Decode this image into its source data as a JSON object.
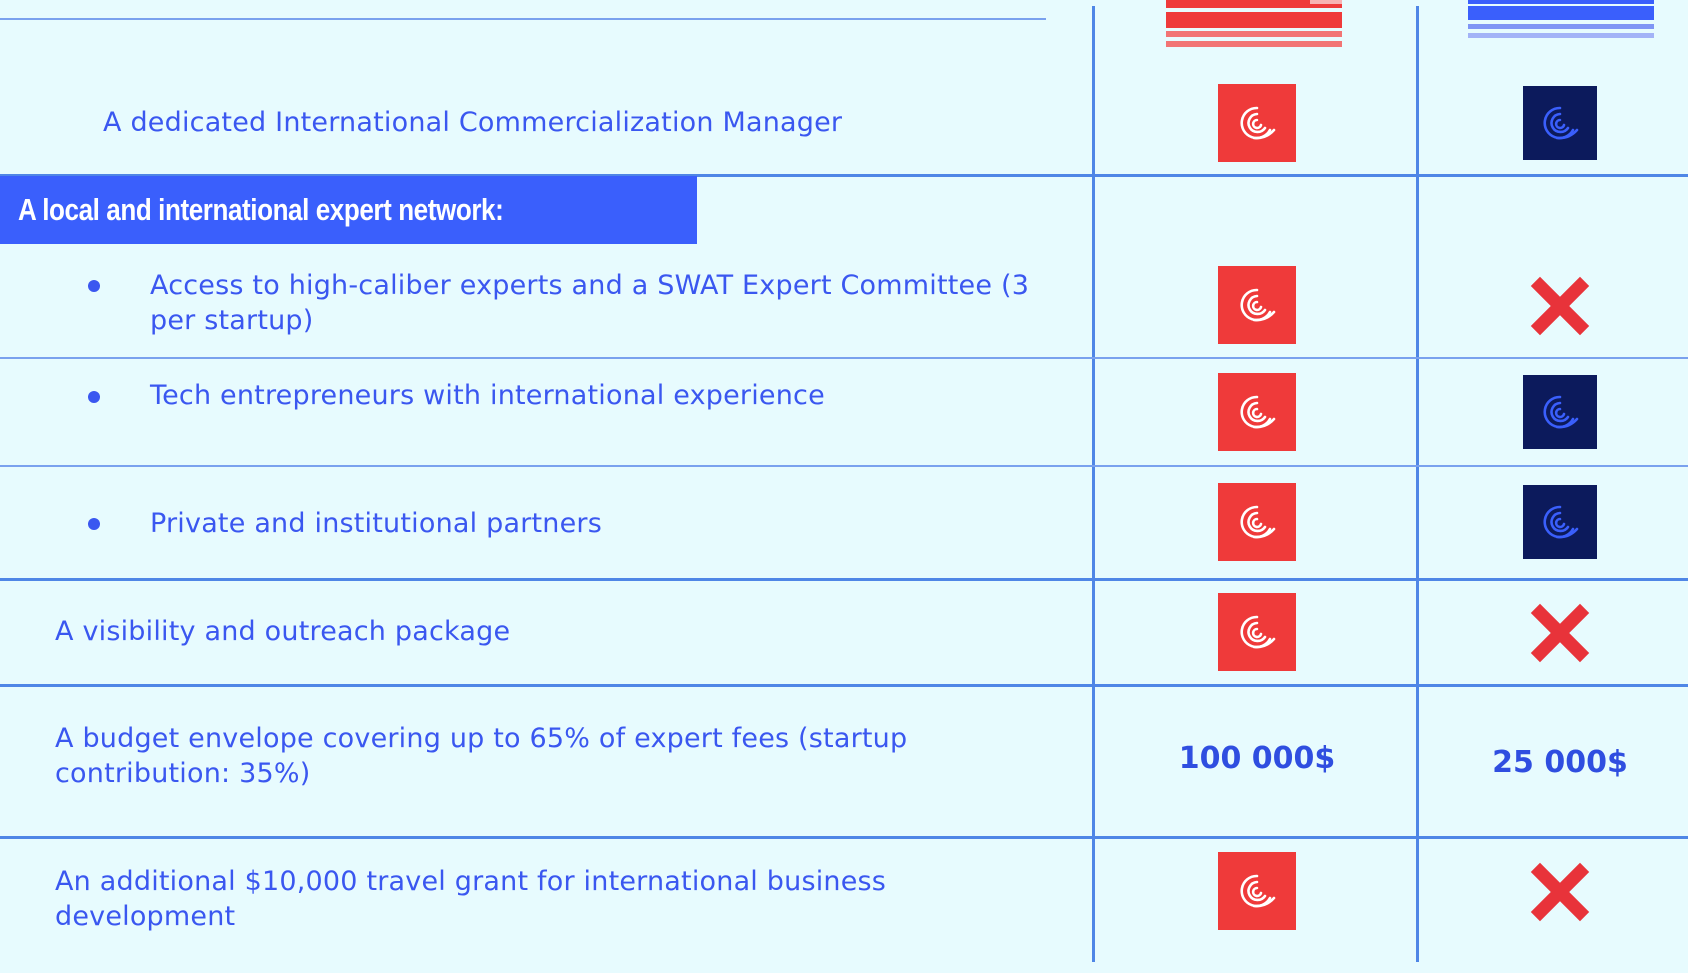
{
  "colors": {
    "background": "#e7fbfe",
    "accent_blue": "#3a5ffc",
    "text_blue": "#3a57f0",
    "grid_blue": "#4f86e6",
    "badge_red": "#ef3a3a",
    "badge_navy": "#0c1a5c",
    "cross_red": "#e8333a"
  },
  "columns": {
    "col1_header": {
      "icon": "red-stripes-icon"
    },
    "col2_header": {
      "icon": "blue-stripes-icon"
    }
  },
  "rows": {
    "manager": {
      "label": "A dedicated International Commercialization Manager",
      "col1": "included",
      "col2": "included"
    },
    "network_section": {
      "title": "A local and international expert network:"
    },
    "experts": {
      "label": "Access to high-caliber experts and a SWAT Expert Committee (3 per startup)",
      "col1": "included",
      "col2": "not-included"
    },
    "entrepreneurs": {
      "label": "Tech entrepreneurs with international experience",
      "col1": "included",
      "col2": "included"
    },
    "partners": {
      "label": "Private and institutional partners",
      "col1": "included",
      "col2": "included"
    },
    "visibility": {
      "label": "A visibility and outreach package",
      "col1": "included",
      "col2": "not-included"
    },
    "budget": {
      "label": "A budget envelope covering up to 65% of expert fees (startup contribution: 35%)",
      "col1": "100 000$",
      "col2": "25 000$"
    },
    "travel": {
      "label": "An additional $10,000 travel grant for international business development",
      "col1": "included",
      "col2": "not-included"
    }
  }
}
